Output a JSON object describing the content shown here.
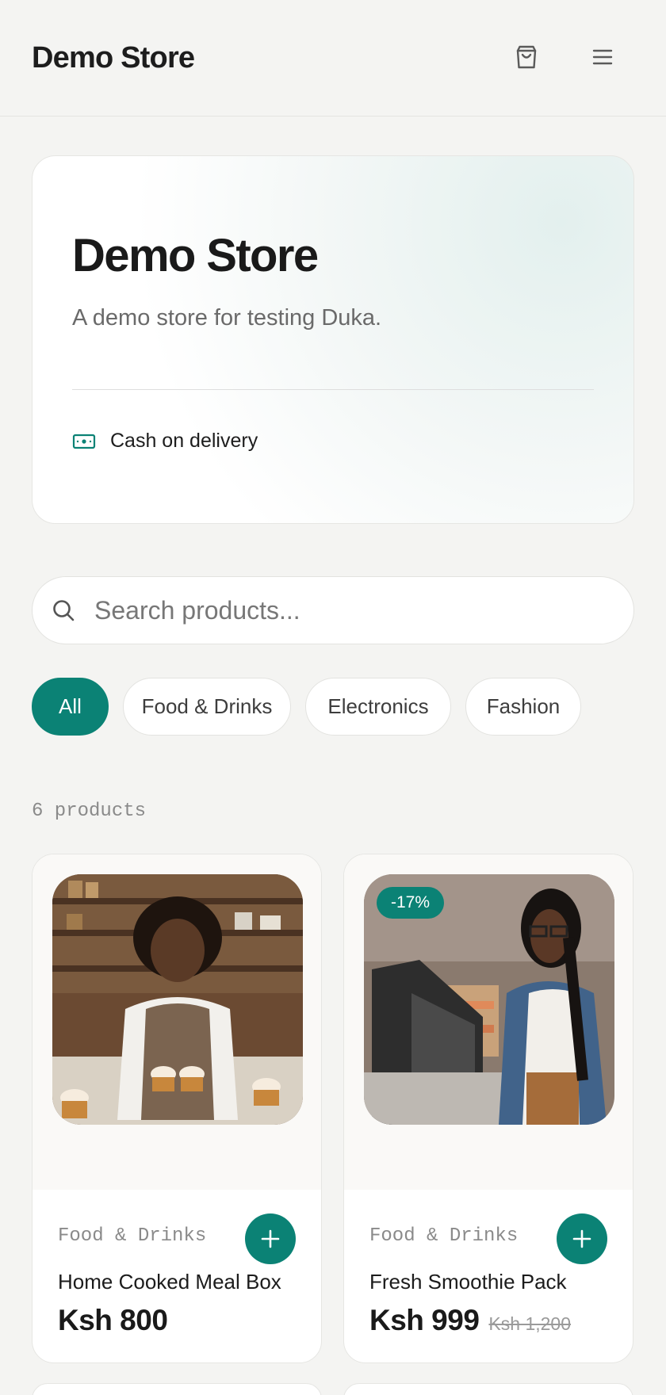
{
  "header": {
    "brand": "Demo Store",
    "cart_icon": "shopping-bag-icon",
    "menu_icon": "hamburger-menu-icon"
  },
  "hero": {
    "title": "Demo Store",
    "subtitle": "A demo store for testing Duka.",
    "payment_icon": "cash-icon",
    "payment_label": "Cash on delivery"
  },
  "search": {
    "placeholder": "Search products...",
    "icon": "search-icon",
    "value": ""
  },
  "categories": [
    {
      "label": "All",
      "active": true
    },
    {
      "label": "Food & Drinks",
      "active": false
    },
    {
      "label": "Electronics",
      "active": false
    },
    {
      "label": "Fashion",
      "active": false
    }
  ],
  "product_count": "6 products",
  "products": [
    {
      "category": "Food & Drinks",
      "name": "Home Cooked Meal Box",
      "price": "Ksh 800",
      "old_price": "",
      "badge": "",
      "image": "baker-with-cupcakes-photo"
    },
    {
      "category": "Food & Drinks",
      "name": "Fresh Smoothie Pack",
      "price": "Ksh 999",
      "old_price": "Ksh 1,200",
      "badge": "-17%",
      "image": "cashier-at-register-photo"
    }
  ],
  "colors": {
    "accent": "#0b8275",
    "background": "#f4f4f2",
    "card": "#ffffff"
  }
}
